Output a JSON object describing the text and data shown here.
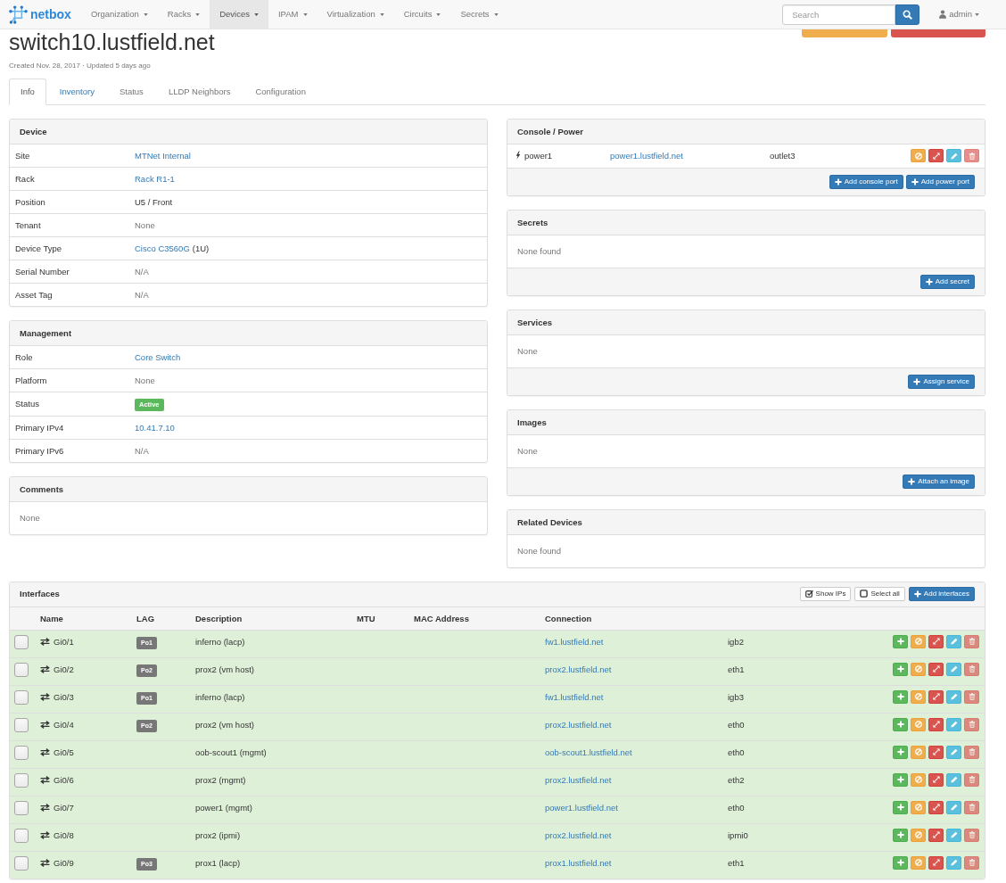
{
  "navbar": {
    "brand": "netbox",
    "menus": [
      {
        "label": "Organization",
        "selected": false
      },
      {
        "label": "Racks",
        "selected": false
      },
      {
        "label": "Devices",
        "selected": true
      },
      {
        "label": "IPAM",
        "selected": false
      },
      {
        "label": "Virtualization",
        "selected": false
      },
      {
        "label": "Circuits",
        "selected": false
      },
      {
        "label": "Secrets",
        "selected": false
      }
    ],
    "search": {
      "placeholder": "Search"
    },
    "user": "admin"
  },
  "header": {
    "title": "switch10.lustfield.net",
    "meta": "Created Nov. 28, 2017 · Updated 5 days ago",
    "buttons": [
      {
        "kind": "warning"
      },
      {
        "kind": "danger"
      }
    ]
  },
  "tabs": [
    {
      "label": "Info",
      "selected": true,
      "disabled": false
    },
    {
      "label": "Inventory",
      "selected": false,
      "disabled": false
    },
    {
      "label": "Status",
      "selected": false,
      "disabled": true
    },
    {
      "label": "LLDP Neighbors",
      "selected": false,
      "disabled": true
    },
    {
      "label": "Configuration",
      "selected": false,
      "disabled": true
    }
  ],
  "left_panels": [
    {
      "kind": "attributes",
      "title": "Device",
      "rows": [
        {
          "label": "Site",
          "value": "MTNet Internal",
          "kind": "link"
        },
        {
          "label": "Rack",
          "value": "Rack R1-1",
          "kind": "link"
        },
        {
          "label": "Position",
          "value": "U5 / Front",
          "kind": "text"
        },
        {
          "label": "Tenant",
          "value": "None",
          "kind": "muted"
        },
        {
          "label": "Device Type",
          "value": "Cisco C3560G",
          "kind": "link",
          "suffix": "(1U)"
        },
        {
          "label": "Serial Number",
          "value": "N/A",
          "kind": "muted"
        },
        {
          "label": "Asset Tag",
          "value": "N/A",
          "kind": "muted"
        }
      ]
    },
    {
      "kind": "attributes",
      "title": "Management",
      "rows": [
        {
          "label": "Role",
          "value": "Core Switch",
          "kind": "link"
        },
        {
          "label": "Platform",
          "value": "None",
          "kind": "muted"
        },
        {
          "label": "Status",
          "value": "Active",
          "kind": "badge"
        },
        {
          "label": "Primary IPv4",
          "value": "10.41.7.10",
          "kind": "link"
        },
        {
          "label": "Primary IPv6",
          "value": "N/A",
          "kind": "muted"
        }
      ]
    },
    {
      "kind": "message",
      "title": "Comments",
      "text": "None"
    }
  ],
  "right_panels": [
    {
      "kind": "ports",
      "title": "Console / Power",
      "ports": [
        {
          "kind": "power",
          "name": "power1",
          "device": "power1.lustfield.net",
          "port": "outlet3",
          "delete_disabled": true
        }
      ],
      "buttons": [
        "Add console port",
        "Add power port"
      ]
    },
    {
      "kind": "message",
      "title": "Secrets",
      "text": "None found",
      "buttons": [
        "Add secret"
      ]
    },
    {
      "kind": "message",
      "title": "Services",
      "text": "None",
      "buttons": [
        "Assign service"
      ]
    },
    {
      "kind": "message",
      "title": "Images",
      "text": "None",
      "buttons": [
        "Attach an image"
      ]
    },
    {
      "kind": "message",
      "title": "Related Devices",
      "text": "None found"
    }
  ],
  "interfaces": {
    "title": "Interfaces",
    "toolbar": [
      {
        "kind": "toggle",
        "label": "Show IPs",
        "checked": true
      },
      {
        "kind": "toggle",
        "label": "Select all",
        "checked": false
      },
      {
        "kind": "add",
        "label": "Add interfaces"
      }
    ],
    "columns": [
      "Name",
      "LAG",
      "Description",
      "MTU",
      "MAC Address",
      "Connection"
    ],
    "rows": [
      {
        "checked": false,
        "connected": true,
        "name": "Gi0/1",
        "lag": "Po1",
        "description": "inferno (lacp)",
        "device": "fw1.lustfield.net",
        "port": "igb2",
        "delete_disabled": true
      },
      {
        "checked": false,
        "connected": true,
        "name": "Gi0/2",
        "lag": "Po2",
        "description": "prox2 (vm host)",
        "device": "prox2.lustfield.net",
        "port": "eth1",
        "delete_disabled": true
      },
      {
        "checked": false,
        "connected": true,
        "name": "Gi0/3",
        "lag": "Po1",
        "description": "inferno (lacp)",
        "device": "fw1.lustfield.net",
        "port": "igb3",
        "delete_disabled": true
      },
      {
        "checked": false,
        "connected": true,
        "name": "Gi0/4",
        "lag": "Po2",
        "description": "prox2 (vm host)",
        "device": "prox2.lustfield.net",
        "port": "eth0",
        "delete_disabled": true
      },
      {
        "checked": false,
        "connected": true,
        "name": "Gi0/5",
        "description": "oob-scout1 (mgmt)",
        "device": "oob-scout1.lustfield.net",
        "port": "eth0",
        "delete_disabled": true
      },
      {
        "checked": false,
        "connected": true,
        "name": "Gi0/6",
        "description": "prox2 (mgmt)",
        "device": "prox2.lustfield.net",
        "port": "eth2",
        "delete_disabled": true
      },
      {
        "checked": false,
        "connected": true,
        "name": "Gi0/7",
        "description": "power1 (mgmt)",
        "device": "power1.lustfield.net",
        "port": "eth0",
        "delete_disabled": true
      },
      {
        "checked": false,
        "connected": true,
        "name": "Gi0/8",
        "description": "prox2 (ipmi)",
        "device": "prox2.lustfield.net",
        "port": "ipmi0",
        "delete_disabled": true
      },
      {
        "checked": false,
        "connected": true,
        "name": "Gi0/9",
        "lag": "Po3",
        "description": "prox1 (lacp)",
        "device": "prox1.lustfield.net",
        "port": "eth1",
        "delete_disabled": true
      }
    ]
  }
}
